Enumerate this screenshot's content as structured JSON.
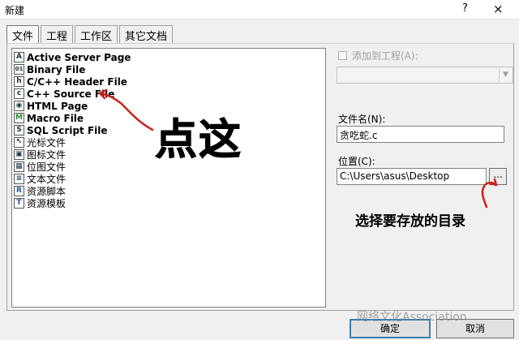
{
  "window": {
    "title": "新建",
    "help_label": "?",
    "close_label": "×"
  },
  "tabs": [
    "文件",
    "工程",
    "工作区",
    "其它文档"
  ],
  "file_types": [
    {
      "label": "Active Server Page",
      "icon": "asp-icon",
      "glyph": "A"
    },
    {
      "label": "Binary File",
      "icon": "binary-file-icon",
      "glyph": "01"
    },
    {
      "label": "C/C++ Header File",
      "icon": "header-file-icon",
      "glyph": "h"
    },
    {
      "label": "C++ Source File",
      "icon": "source-file-icon",
      "glyph": "c"
    },
    {
      "label": "HTML Page",
      "icon": "html-page-icon",
      "glyph": "◉"
    },
    {
      "label": "Macro File",
      "icon": "macro-file-icon",
      "glyph": "M"
    },
    {
      "label": "SQL Script File",
      "icon": "sql-file-icon",
      "glyph": "S"
    },
    {
      "label": "光标文件",
      "icon": "cursor-file-icon",
      "glyph": "↖"
    },
    {
      "label": "图标文件",
      "icon": "icon-file-icon",
      "glyph": "▣"
    },
    {
      "label": "位图文件",
      "icon": "bitmap-file-icon",
      "glyph": "▦"
    },
    {
      "label": "文本文件",
      "icon": "text-file-icon",
      "glyph": "≡"
    },
    {
      "label": "资源脚本",
      "icon": "resource-script-icon",
      "glyph": "R"
    },
    {
      "label": "资源模板",
      "icon": "resource-template-icon",
      "glyph": "T"
    }
  ],
  "add_to_project": {
    "label": "添加到工程(A):",
    "checked": false,
    "enabled": false,
    "value": ""
  },
  "filename": {
    "label": "文件名(N):",
    "value": "贪吃蛇.c"
  },
  "location": {
    "label": "位置(C):",
    "value": "C:\\Users\\asus\\Desktop",
    "browse_label": "..."
  },
  "annotations": {
    "big": "点这",
    "small": "选择要存放的目录"
  },
  "buttons": {
    "ok": "确定",
    "cancel": "取消"
  },
  "watermark": "网络文化Association",
  "colors": {
    "annotation_arrow": "#c8231c",
    "default_button_border": "#3c7fb1"
  }
}
